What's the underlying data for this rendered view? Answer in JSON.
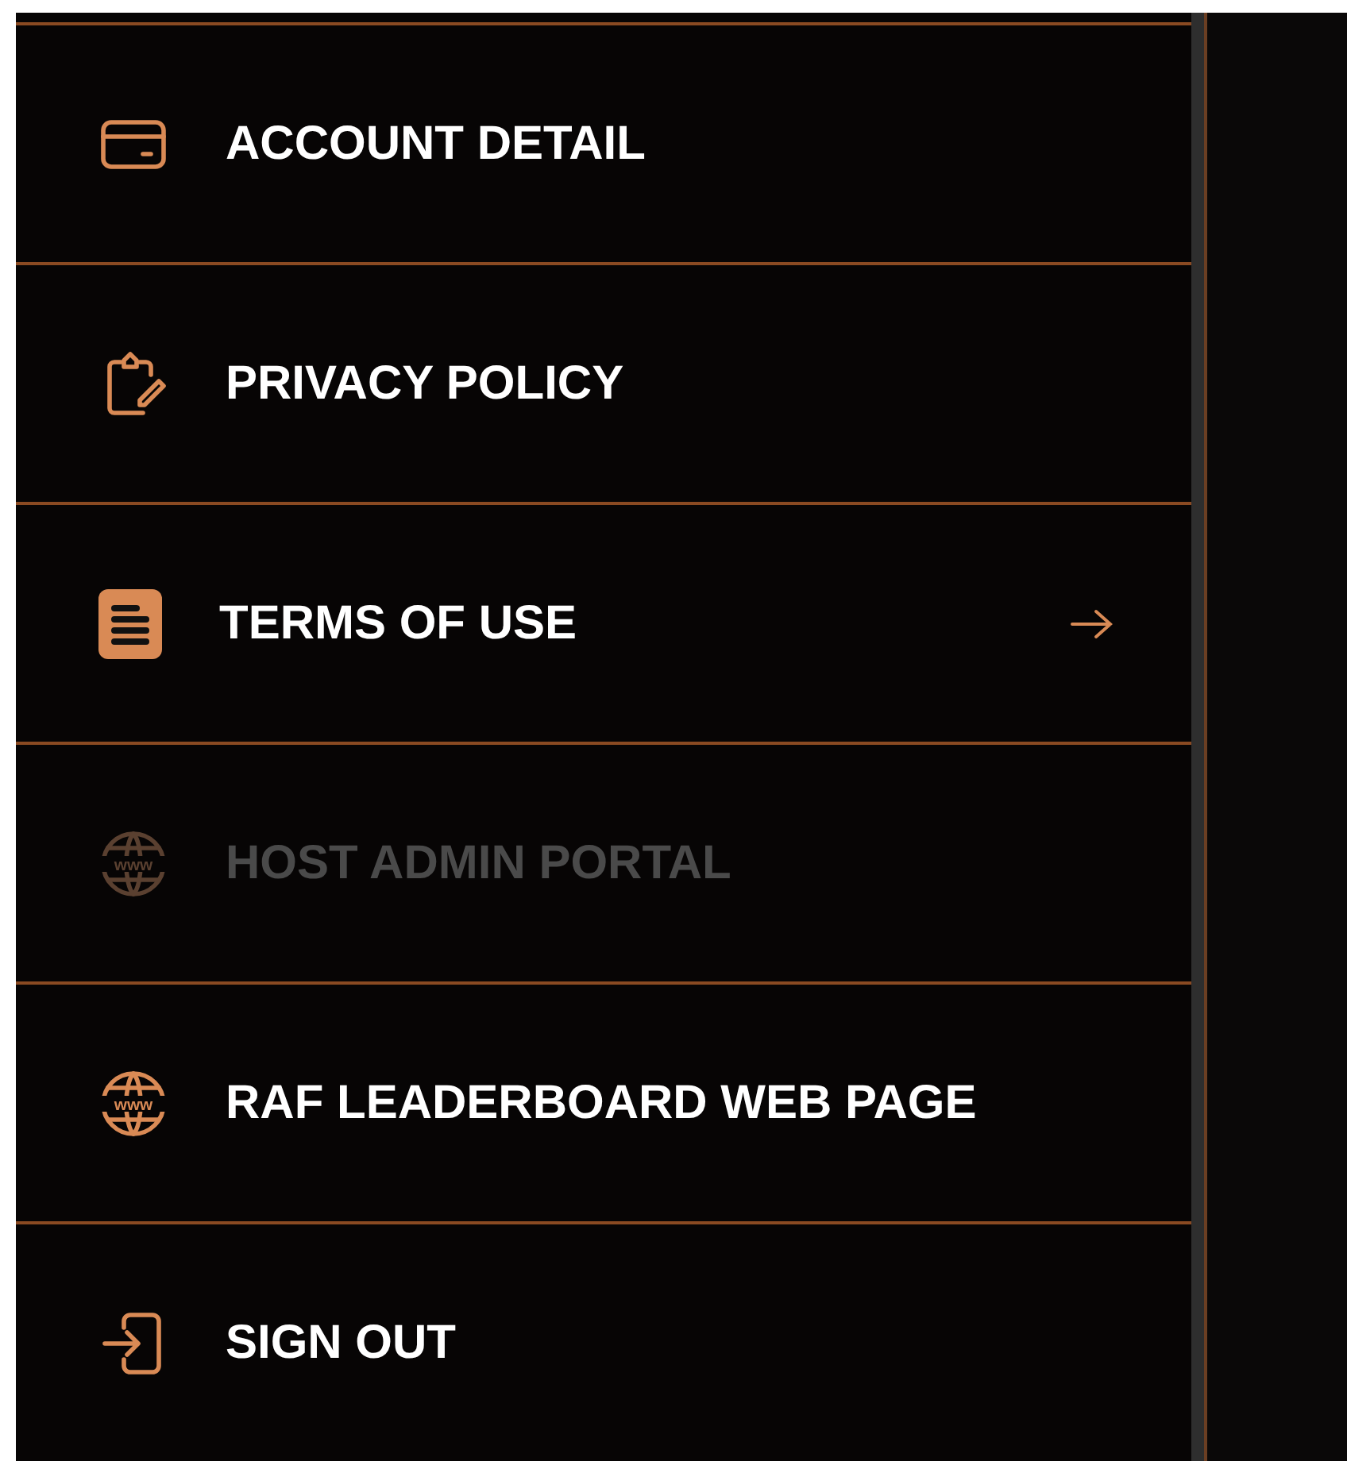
{
  "menu": {
    "items": [
      {
        "kind": "card",
        "label": "ACCOUNT DETAIL",
        "disabled": false,
        "active": false
      },
      {
        "kind": "clipboard",
        "label": "PRIVACY POLICY",
        "disabled": false,
        "active": false
      },
      {
        "kind": "document",
        "label": "TERMS OF USE",
        "disabled": false,
        "active": true
      },
      {
        "kind": "globe",
        "icon_text": "www",
        "label": "HOST ADMIN PORTAL",
        "disabled": true,
        "active": false
      },
      {
        "kind": "globe",
        "icon_text": "www",
        "label": "RAF LEADERBOARD WEB PAGE",
        "disabled": false,
        "active": false
      },
      {
        "kind": "signout",
        "label": "SIGN OUT",
        "disabled": false,
        "active": false
      }
    ]
  }
}
